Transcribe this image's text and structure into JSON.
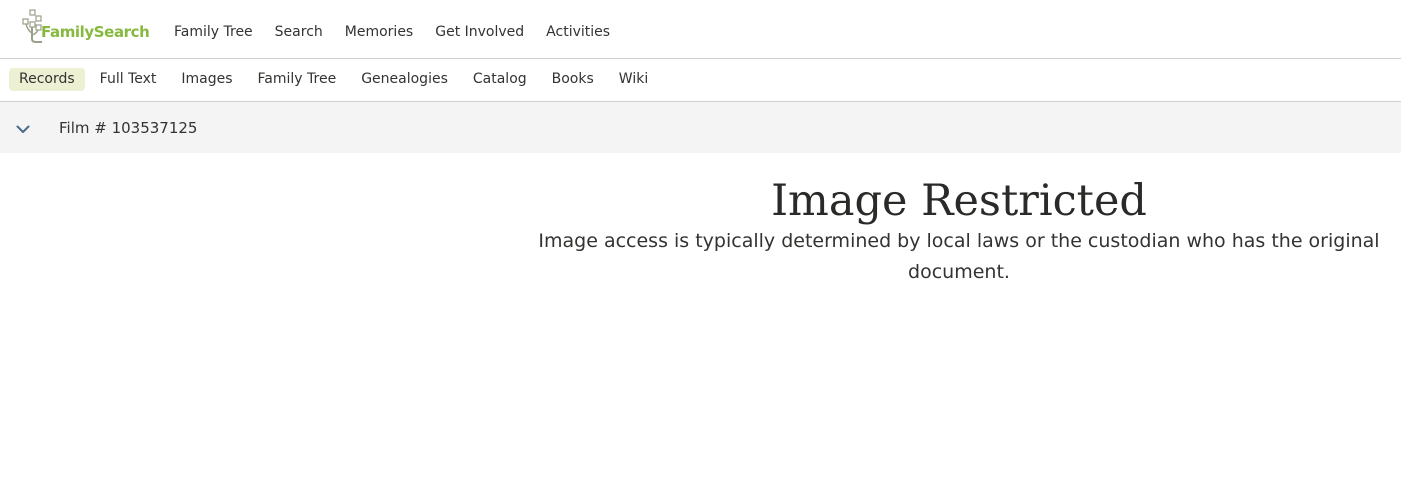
{
  "brand": {
    "name": "FamilySearch",
    "color": "#87b940"
  },
  "primary_nav": [
    {
      "label": "Family Tree"
    },
    {
      "label": "Search"
    },
    {
      "label": "Memories"
    },
    {
      "label": "Get Involved"
    },
    {
      "label": "Activities"
    }
  ],
  "sub_nav": [
    {
      "label": "Records",
      "active": true
    },
    {
      "label": "Full Text"
    },
    {
      "label": "Images"
    },
    {
      "label": "Family Tree"
    },
    {
      "label": "Genealogies"
    },
    {
      "label": "Catalog"
    },
    {
      "label": "Books"
    },
    {
      "label": "Wiki"
    }
  ],
  "film_bar": {
    "label": "Film # 103537125",
    "icon": "chevron-down-icon"
  },
  "message": {
    "title": "Image Restricted",
    "body": "Image access is typically determined by local laws or the custodian who has the original document."
  },
  "colors": {
    "active_tab_bg": "#eef0d3",
    "film_bar_bg": "#f4f4f4",
    "chevron": "#4a6a8a"
  }
}
